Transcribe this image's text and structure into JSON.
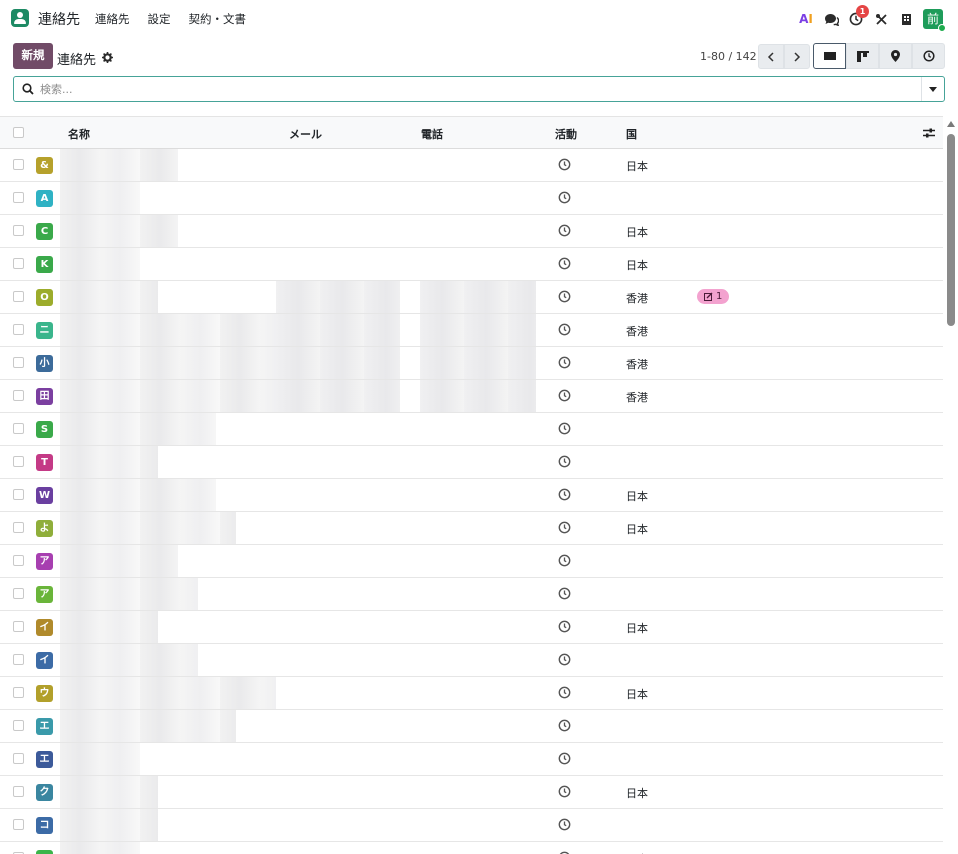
{
  "navbar": {
    "app_name": "連絡先",
    "menu": [
      "連絡先",
      "設定",
      "契約・文書"
    ],
    "ai_label_a": "A",
    "ai_label_i": "I",
    "activity_badge": "1",
    "user_avatar": "前"
  },
  "control": {
    "new_button": "新規",
    "title": "連絡先",
    "pager": "1-80 / 142"
  },
  "search": {
    "placeholder": "検索..."
  },
  "table": {
    "headers": {
      "name": "名称",
      "email": "メール",
      "phone": "電話",
      "activity": "活動",
      "country": "国"
    },
    "rows": [
      {
        "initial": "&",
        "color": "#b6a12b",
        "country": "日本",
        "tag": ""
      },
      {
        "initial": "A",
        "color": "#2fb2c4",
        "country": "",
        "tag": ""
      },
      {
        "initial": "C",
        "color": "#3aa94a",
        "country": "日本",
        "tag": ""
      },
      {
        "initial": "K",
        "color": "#3aa94a",
        "country": "日本",
        "tag": ""
      },
      {
        "initial": "O",
        "color": "#9cac2b",
        "country": "香港",
        "tag": "1"
      },
      {
        "initial": "ニ",
        "color": "#3ab58c",
        "country": "香港",
        "tag": ""
      },
      {
        "initial": "小",
        "color": "#3c6b9a",
        "country": "香港",
        "tag": ""
      },
      {
        "initial": "田",
        "color": "#7b3fa0",
        "country": "香港",
        "tag": ""
      },
      {
        "initial": "S",
        "color": "#3aa94a",
        "country": "",
        "tag": ""
      },
      {
        "initial": "T",
        "color": "#c43a86",
        "country": "",
        "tag": ""
      },
      {
        "initial": "W",
        "color": "#6a3fa0",
        "country": "日本",
        "tag": ""
      },
      {
        "initial": "よ",
        "color": "#8fae3a",
        "country": "日本",
        "tag": ""
      },
      {
        "initial": "ア",
        "color": "#a73fb0",
        "country": "",
        "tag": ""
      },
      {
        "initial": "ア",
        "color": "#6ab53a",
        "country": "",
        "tag": ""
      },
      {
        "initial": "イ",
        "color": "#b08a2b",
        "country": "日本",
        "tag": ""
      },
      {
        "initial": "イ",
        "color": "#3c6ba6",
        "country": "",
        "tag": ""
      },
      {
        "initial": "ウ",
        "color": "#b2a02b",
        "country": "日本",
        "tag": ""
      },
      {
        "initial": "エ",
        "color": "#3a9aaa",
        "country": "",
        "tag": ""
      },
      {
        "initial": "エ",
        "color": "#3c5a9a",
        "country": "",
        "tag": ""
      },
      {
        "initial": "ク",
        "color": "#3a86a0",
        "country": "日本",
        "tag": ""
      },
      {
        "initial": "コ",
        "color": "#3c6ba6",
        "country": "",
        "tag": ""
      },
      {
        "initial": "",
        "color": "#3ab54a",
        "country": "日本",
        "tag": ""
      }
    ]
  }
}
